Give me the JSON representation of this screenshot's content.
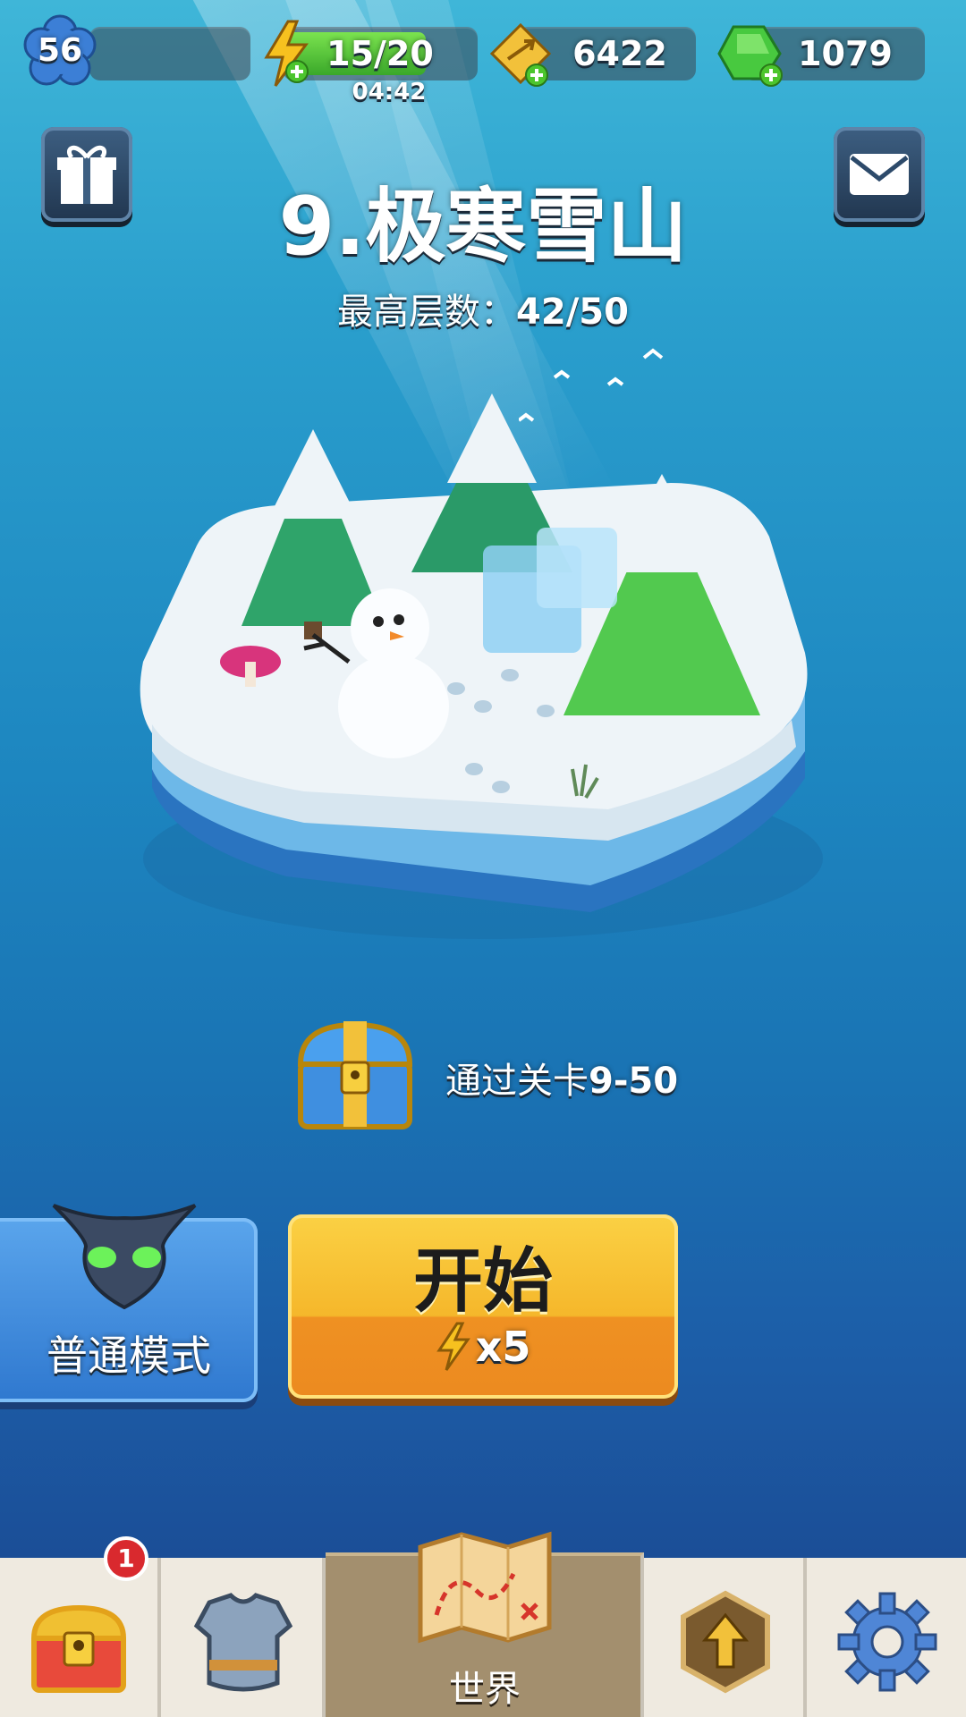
{
  "top_bar": {
    "level": "56",
    "energy": {
      "value": "15/20",
      "timer": "04:42",
      "fill": 0.75,
      "icon": "lightning-icon"
    },
    "tokens": {
      "value": "6422",
      "icon": "arrow-token-icon"
    },
    "gems": {
      "value": "1079",
      "icon": "green-gem-icon"
    }
  },
  "stage": {
    "title": "9.极寒雪山",
    "best_label": "最高层数：",
    "best_value": "42/50"
  },
  "reward": {
    "text": "通过关卡",
    "stage": "9-50",
    "icon": "treasure-chest-icon"
  },
  "buttons": {
    "mode_label": "普通模式",
    "start_label": "开始",
    "start_cost": "x5"
  },
  "nav": {
    "chest_badge": "1",
    "world_label": "世界",
    "items": [
      "chest-icon",
      "armor-icon",
      "map-icon",
      "upgrade-arrow-icon",
      "gear-icon"
    ]
  },
  "colors": {
    "energy_bar": "#5bd33a",
    "start_button": "#f5b72b",
    "mode_button": "#3f8ee0",
    "badge": "#d9292e"
  }
}
